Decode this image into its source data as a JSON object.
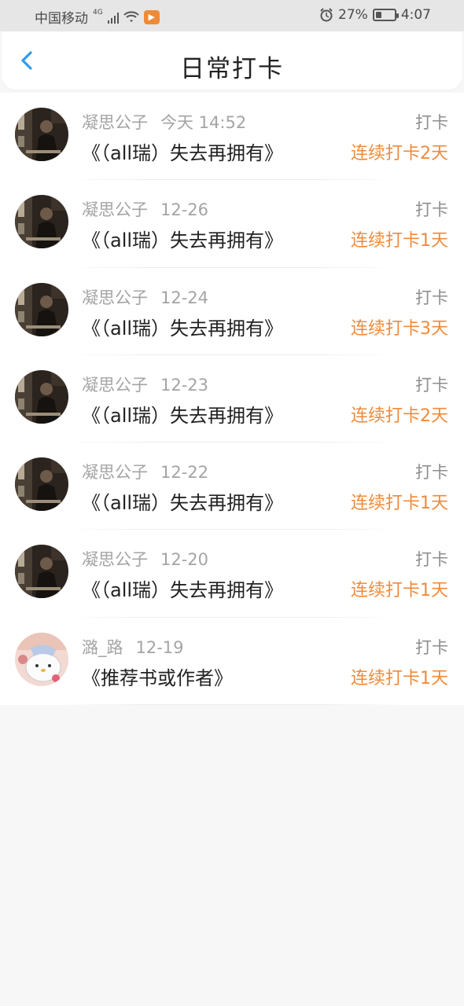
{
  "status_bar": {
    "carrier": "中国移动",
    "network": "4G",
    "battery_percent": "27%",
    "battery_level": 0.27,
    "time": "4:07"
  },
  "nav": {
    "title": "日常打卡",
    "back_icon": "chevron-left-icon"
  },
  "colors": {
    "accent_orange": "#f08a3a",
    "back_blue": "#2f9be6"
  },
  "items": [
    {
      "name": "凝思公子",
      "date": "今天 14:52",
      "title": "《（all瑞）失去再拥有》",
      "tag": "打卡",
      "streak": "连续打卡2天",
      "avatar": "photo-avatar"
    },
    {
      "name": "凝思公子",
      "date": "12-26",
      "title": "《（all瑞）失去再拥有》",
      "tag": "打卡",
      "streak": "连续打卡1天",
      "avatar": "photo-avatar"
    },
    {
      "name": "凝思公子",
      "date": "12-24",
      "title": "《（all瑞）失去再拥有》",
      "tag": "打卡",
      "streak": "连续打卡3天",
      "avatar": "photo-avatar"
    },
    {
      "name": "凝思公子",
      "date": "12-23",
      "title": "《（all瑞）失去再拥有》",
      "tag": "打卡",
      "streak": "连续打卡2天",
      "avatar": "photo-avatar"
    },
    {
      "name": "凝思公子",
      "date": "12-22",
      "title": "《（all瑞）失去再拥有》",
      "tag": "打卡",
      "streak": "连续打卡1天",
      "avatar": "photo-avatar"
    },
    {
      "name": "凝思公子",
      "date": "12-20",
      "title": "《（all瑞）失去再拥有》",
      "tag": "打卡",
      "streak": "连续打卡1天",
      "avatar": "photo-avatar"
    },
    {
      "name": "潞_路",
      "date": "12-19",
      "title": "《推荐书或作者》",
      "tag": "打卡",
      "streak": "连续打卡1天",
      "avatar": "cartoon-avatar"
    }
  ]
}
